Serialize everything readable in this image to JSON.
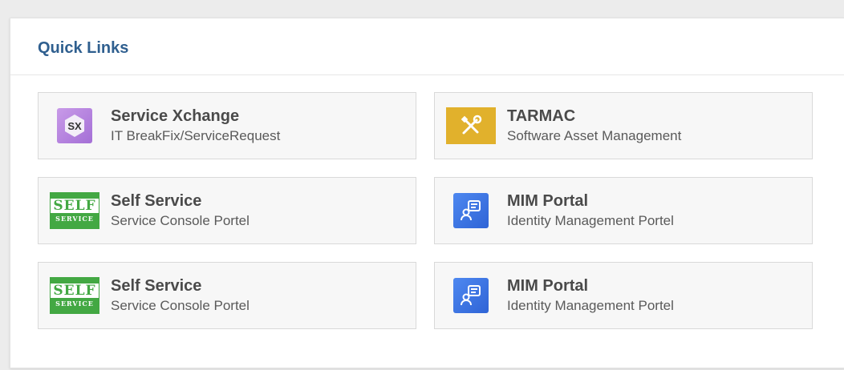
{
  "panel": {
    "title": "Quick Links"
  },
  "links": [
    {
      "title": "Service Xchange",
      "subtitle": "IT BreakFix/ServiceRequest",
      "icon": "service-xchange-icon",
      "icon_text": "SX",
      "color": "#b07fe0"
    },
    {
      "title": "TARMAC",
      "subtitle": "Software Asset Management",
      "icon": "tools-icon",
      "color": "#e1b12c"
    },
    {
      "title": "Self Service",
      "subtitle": "Service Console Portel",
      "icon": "self-service-icon",
      "icon_text_top": "SELF",
      "icon_text_bottom": "SERVICE",
      "color": "#43a843"
    },
    {
      "title": "MIM Portal",
      "subtitle": "Identity Management Portel",
      "icon": "identity-chat-icon",
      "color": "#3a74e6"
    },
    {
      "title": "Self Service",
      "subtitle": "Service Console Portel",
      "icon": "self-service-icon",
      "icon_text_top": "SELF",
      "icon_text_bottom": "SERVICE",
      "color": "#43a843"
    },
    {
      "title": "MIM Portal",
      "subtitle": "Identity Management Portel",
      "icon": "identity-chat-icon",
      "color": "#3a74e6"
    }
  ]
}
